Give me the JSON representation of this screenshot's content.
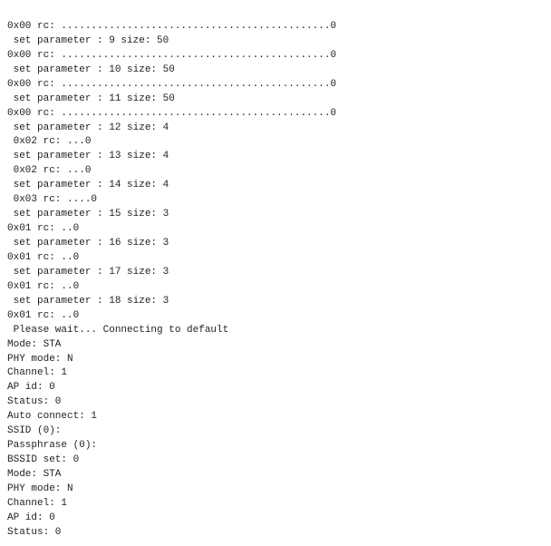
{
  "terminal": {
    "lines": [
      "0x00 rc: .............................................0",
      " set parameter : 9 size: 50",
      "0x00 rc: .............................................0",
      " set parameter : 10 size: 50",
      "0x00 rc: .............................................0",
      " set parameter : 11 size: 50",
      "0x00 rc: .............................................0",
      " set parameter : 12 size: 4",
      " 0x02 rc: ...0",
      " set parameter : 13 size: 4",
      " 0x02 rc: ...0",
      " set parameter : 14 size: 4",
      " 0x03 rc: ....0",
      " set parameter : 15 size: 3",
      "0x01 rc: ..0",
      " set parameter : 16 size: 3",
      "0x01 rc: ..0",
      " set parameter : 17 size: 3",
      "0x01 rc: ..0",
      " set parameter : 18 size: 3",
      "0x01 rc: ..0",
      "",
      " Please wait... Connecting to default",
      "Mode: STA",
      "PHY mode: N",
      "Channel: 1",
      "AP id: 0",
      "Status: 0",
      "Auto connect: 1",
      "SSID (0):",
      "Passphrase (0):",
      "BSSID set: 0",
      "Mode: STA",
      "PHY mode: N",
      "Channel: 1",
      "AP id: 0",
      "Status: 0"
    ]
  }
}
